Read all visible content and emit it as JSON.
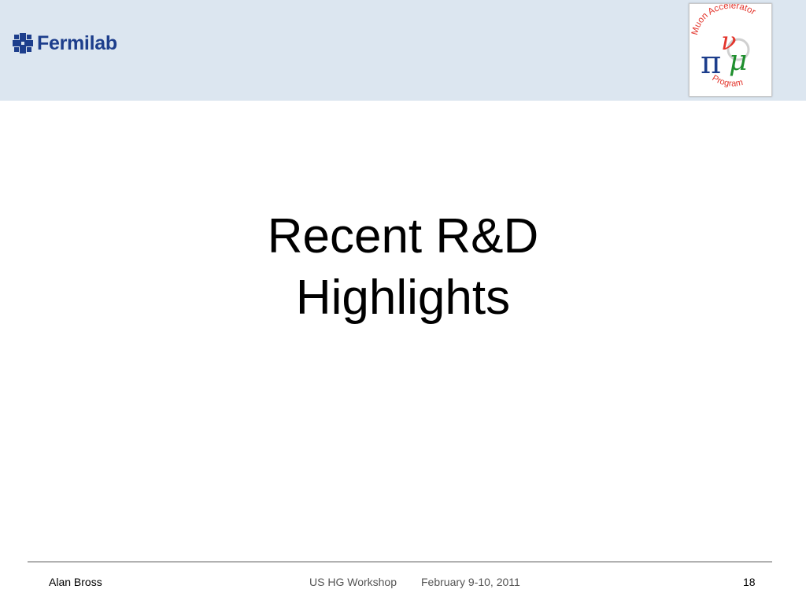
{
  "header": {
    "logo_text": "Fermilab",
    "badge": {
      "arc_top": "Muon Accelerator",
      "arc_bottom": "Program",
      "glyph_pi": "π",
      "glyph_nu": "ν",
      "glyph_mu": "μ",
      "colors": {
        "arc_text": "#e3342b",
        "pi": "#1d3e8c",
        "nu": "#e3342b",
        "mu": "#1f8f2e"
      }
    }
  },
  "slide": {
    "title_line1": "Recent R&D",
    "title_line2": "Highlights"
  },
  "footer": {
    "author": "Alan Bross",
    "event": "US HG Workshop",
    "date": "February 9-10, 2011",
    "page_number": "18"
  },
  "colors": {
    "header_background": "#dce6f0",
    "fermilab_blue": "#1d3e8c"
  }
}
